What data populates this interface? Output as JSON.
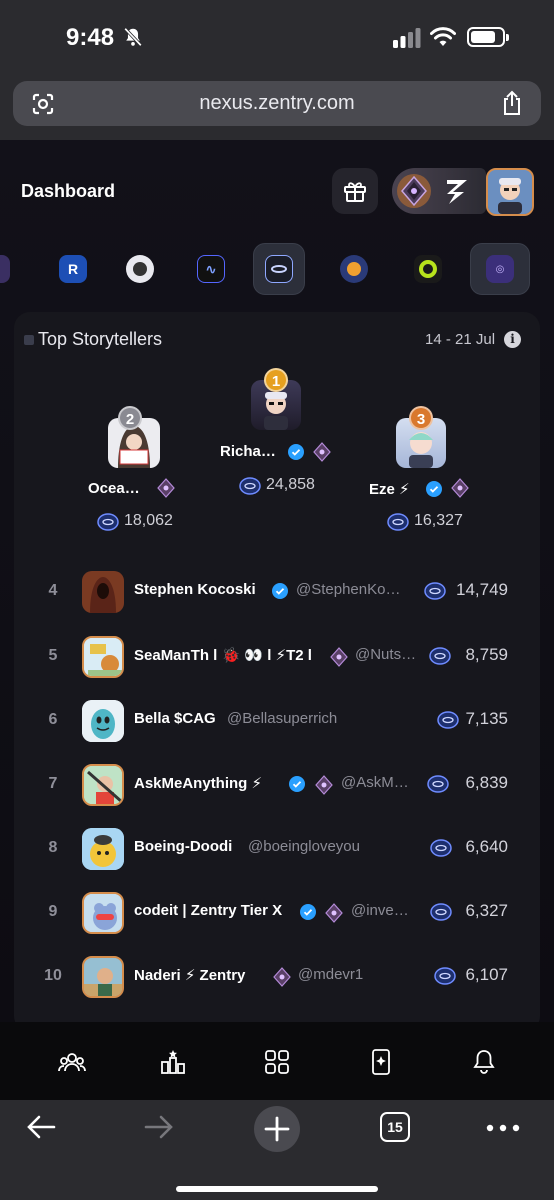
{
  "status_bar": {
    "time": "9:48"
  },
  "browser": {
    "url": "nexus.zentry.com",
    "tab_count": "15"
  },
  "header": {
    "title": "Dashboard"
  },
  "leaderboard": {
    "title": "Top Storytellers",
    "date_range": "14 - 21 Jul",
    "info_icon": "i",
    "podium": [
      {
        "rank": "1",
        "name": "Richa…",
        "score": "24,858",
        "badge_color": "#e6a020"
      },
      {
        "rank": "2",
        "name": "Ocea…",
        "score": "18,062",
        "badge_color": "#8a8a92"
      },
      {
        "rank": "3",
        "name": "Eze ⚡",
        "score": "16,327",
        "badge_color": "#d9782d"
      }
    ],
    "rows": [
      {
        "rank": "4",
        "name": "Stephen Kocoski",
        "handle": "@StephenKo…",
        "score": "14,749"
      },
      {
        "rank": "5",
        "name": "SeaManTh l 🐞 👀 l ⚡T2 l",
        "handle": "@Nuts…",
        "score": "8,759"
      },
      {
        "rank": "6",
        "name": "Bella $CAG",
        "handle": "@Bellasuperrich",
        "score": "7,135"
      },
      {
        "rank": "7",
        "name": "AskMeAnything ⚡",
        "handle": "@AskM…",
        "score": "6,839"
      },
      {
        "rank": "8",
        "name": "Boeing-Doodi",
        "handle": "@boeingloveyou",
        "score": "6,640"
      },
      {
        "rank": "9",
        "name": "codeit | Zentry Tier X",
        "handle": "@inve…",
        "score": "6,327"
      },
      {
        "rank": "10",
        "name": "Naderi ⚡ Zentry",
        "handle": "@mdevr1",
        "score": "6,107"
      }
    ]
  },
  "colors": {
    "accent_blue": "#2aa0ff",
    "badge_gold": "#e6a020",
    "background": "#0d0c12",
    "card": "#17171d"
  }
}
